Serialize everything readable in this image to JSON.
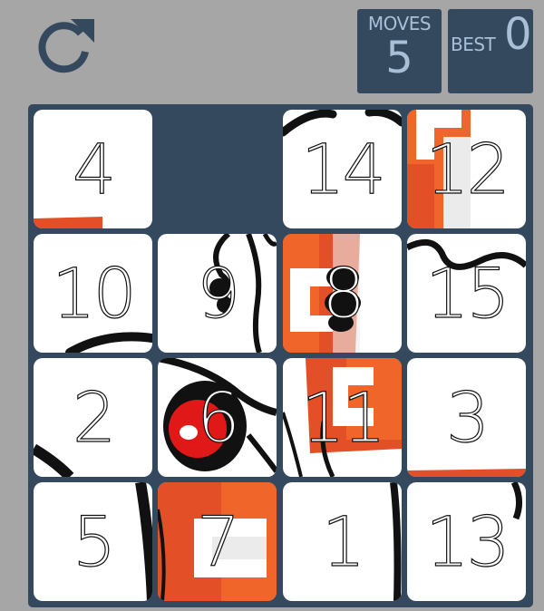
{
  "toolbar": {
    "restart_icon": "refresh-icon",
    "moves_label": "MOVES",
    "moves_value": "5",
    "best_label": "BEST",
    "best_value": "0"
  },
  "board": {
    "rows": 4,
    "cols": 4,
    "tiles": [
      "4",
      "",
      "14",
      "12",
      "10",
      "9",
      "8",
      "15",
      "2",
      "6",
      "11",
      "3",
      "5",
      "7",
      "1",
      "13"
    ]
  },
  "colors": {
    "board": "#34495e",
    "background": "#a6a6a6",
    "score_text": "#a9bfd6",
    "html5_orange": "#e34f26",
    "html5_light": "#f06529",
    "mascot_red": "#e01818"
  }
}
